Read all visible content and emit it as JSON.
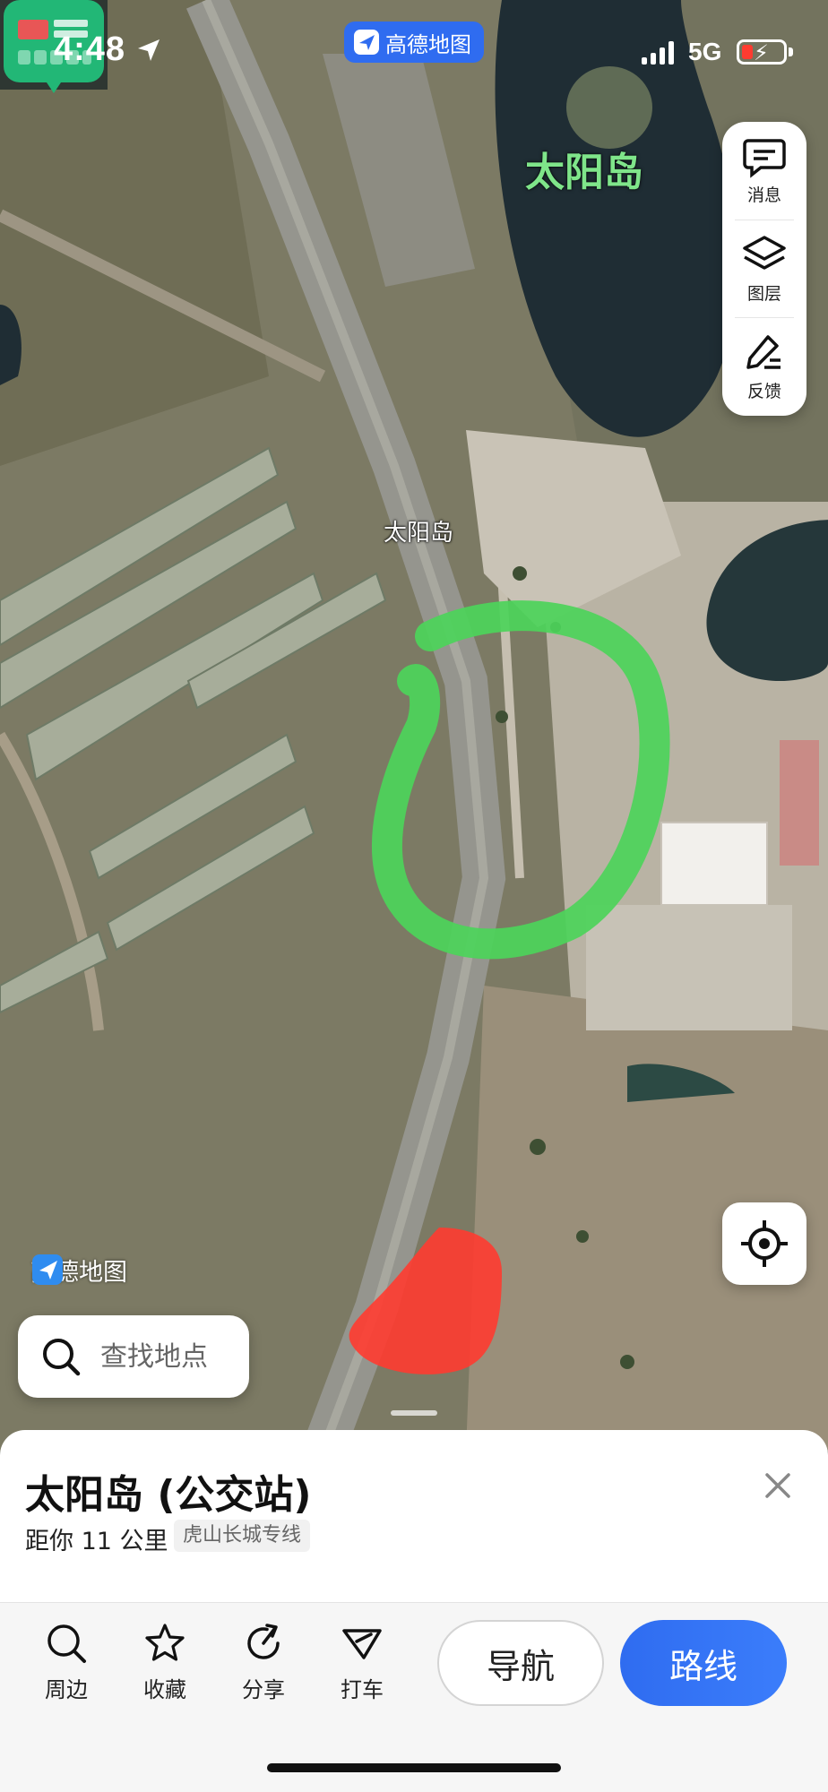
{
  "status_bar": {
    "time": "4:48",
    "network": "5G",
    "app_name": "高德地图",
    "battery_state": "low-charging"
  },
  "map": {
    "area_label": "太阳岛",
    "poi_label": "太阳岛",
    "watermark": "高德地图",
    "annotations": [
      {
        "shape": "circle",
        "color": "#4cd45a"
      },
      {
        "shape": "triangle",
        "color": "#ff3b30"
      }
    ]
  },
  "tools": [
    {
      "label": "消息",
      "icon": "message-icon"
    },
    {
      "label": "图层",
      "icon": "layers-icon"
    },
    {
      "label": "反馈",
      "icon": "feedback-icon"
    }
  ],
  "search": {
    "placeholder": "查找地点"
  },
  "place": {
    "title": "太阳岛 (公交站)",
    "distance": "距你 11 公里",
    "route_tag": "虎山长城专线"
  },
  "actions": [
    {
      "label": "周边",
      "icon": "search-icon"
    },
    {
      "label": "收藏",
      "icon": "star-icon"
    },
    {
      "label": "分享",
      "icon": "share-icon"
    },
    {
      "label": "打车",
      "icon": "taxi-icon"
    }
  ],
  "buttons": {
    "navigate": "导航",
    "route": "路线"
  },
  "colors": {
    "accent": "#2f6cf0",
    "annotation_green": "#4cd45a",
    "annotation_red": "#ff3b30"
  }
}
